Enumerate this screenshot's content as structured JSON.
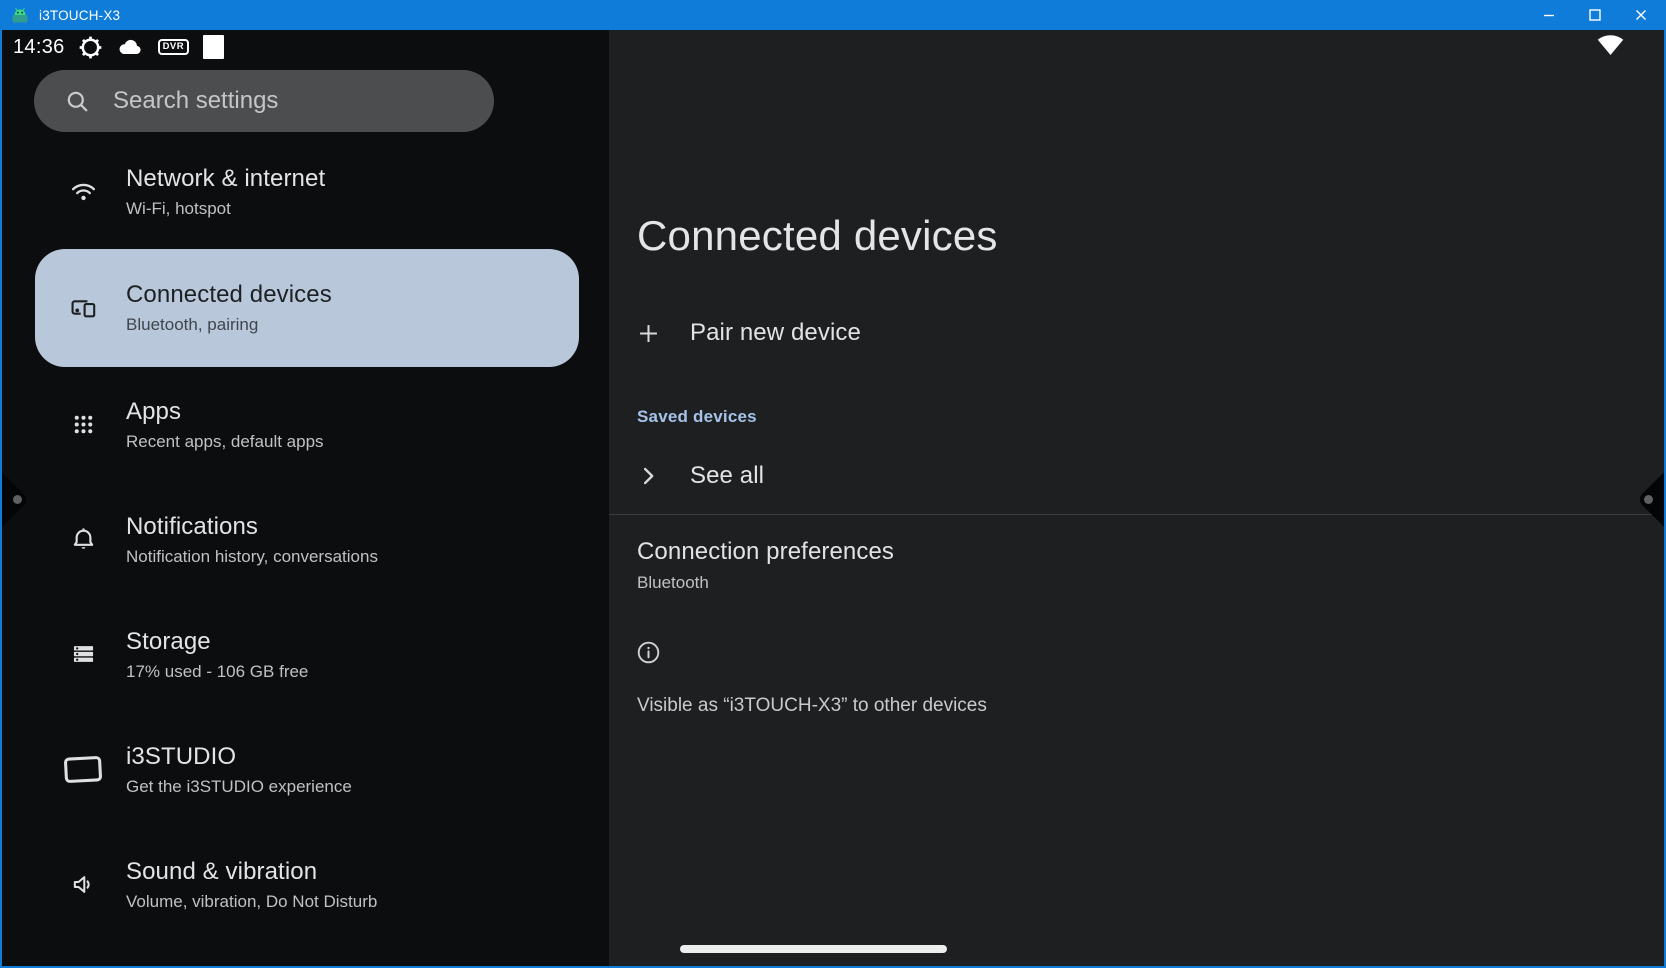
{
  "window": {
    "title": "i3TOUCH-X3"
  },
  "status_bar": {
    "time": "14:36",
    "dvr_badge": "DVR"
  },
  "sidebar": {
    "search": {
      "placeholder": "Search settings"
    },
    "items": [
      {
        "label": "Network & internet",
        "sublabel": "Wi-Fi, hotspot",
        "icon": "wifi-icon",
        "selected": false
      },
      {
        "label": "Connected devices",
        "sublabel": "Bluetooth, pairing",
        "icon": "devices-icon",
        "selected": true
      },
      {
        "label": "Apps",
        "sublabel": "Recent apps, default apps",
        "icon": "apps-grid-icon",
        "selected": false
      },
      {
        "label": "Notifications",
        "sublabel": "Notification history, conversations",
        "icon": "bell-icon",
        "selected": false
      },
      {
        "label": "Storage",
        "sublabel": "17% used - 106 GB free",
        "icon": "storage-icon",
        "selected": false
      },
      {
        "label": "i3STUDIO",
        "sublabel": "Get the i3STUDIO experience",
        "icon": "whiteboard-icon",
        "selected": false
      },
      {
        "label": "Sound & vibration",
        "sublabel": "Volume, vibration, Do Not Disturb",
        "icon": "speaker-icon",
        "selected": false
      }
    ]
  },
  "main": {
    "title": "Connected devices",
    "pair_new_device_label": "Pair new device",
    "saved_devices_header": "Saved devices",
    "see_all_label": "See all",
    "connection_preferences_title": "Connection preferences",
    "connection_preferences_subtitle": "Bluetooth",
    "visibility_note": "Visible as “i3TOUCH-X3” to other devices"
  },
  "colors": {
    "titlebar_accent": "#0e7cd8",
    "sidebar_bg": "#0c0d0e",
    "main_bg": "#1d1f21",
    "selected_item_bg": "#b8c8da",
    "saved_devices_header_text": "#a5c2e8",
    "search_pill_bg": "#4c4d4f",
    "android_green": "#3ddc84"
  }
}
